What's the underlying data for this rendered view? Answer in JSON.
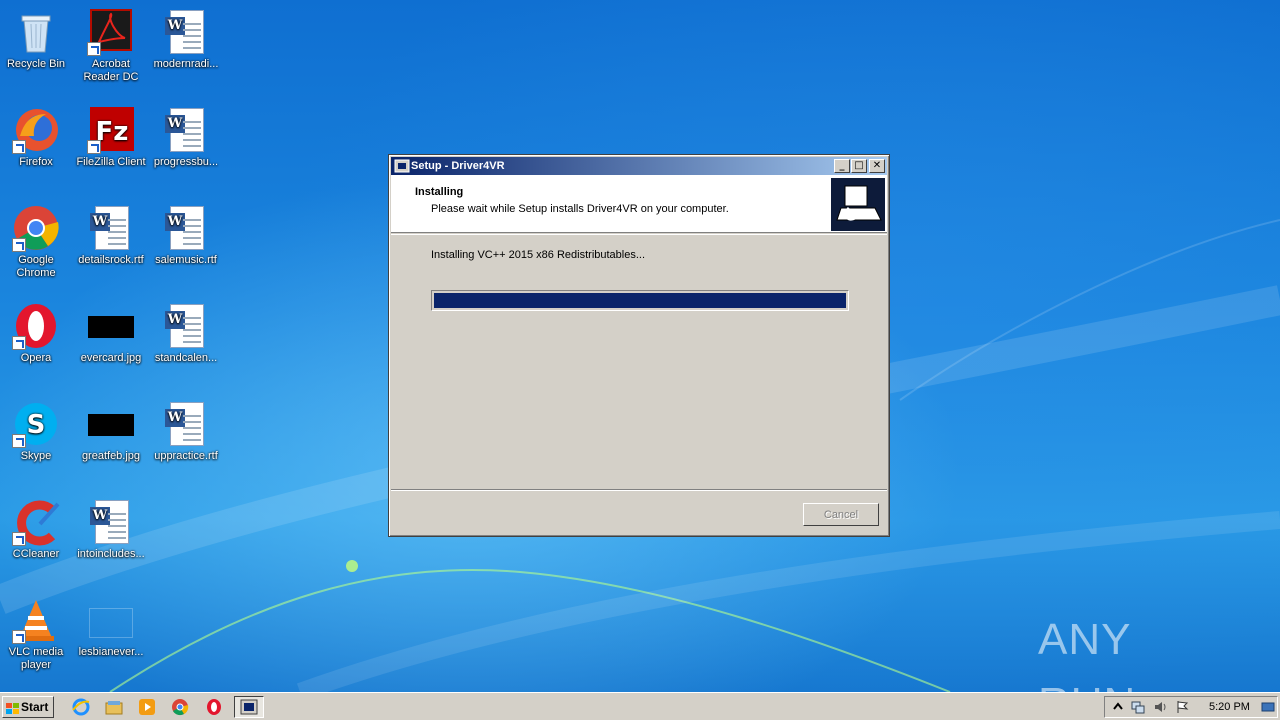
{
  "desktop": {
    "icons": [
      {
        "label": "Recycle Bin"
      },
      {
        "label": "Acrobat Reader DC"
      },
      {
        "label": "modernradi..."
      },
      {
        "label": "Firefox"
      },
      {
        "label": "FileZilla Client"
      },
      {
        "label": "progressbu..."
      },
      {
        "label": "Google Chrome"
      },
      {
        "label": "detailsrock.rtf"
      },
      {
        "label": "salemusic.rtf"
      },
      {
        "label": "Opera"
      },
      {
        "label": "evercard.jpg"
      },
      {
        "label": "standcalen..."
      },
      {
        "label": "Skype"
      },
      {
        "label": "greatfeb.jpg"
      },
      {
        "label": "uppractice.rtf"
      },
      {
        "label": "CCleaner"
      },
      {
        "label": "intoincludes..."
      },
      {
        "label": "VLC media player"
      },
      {
        "label": "lesbianever..."
      }
    ]
  },
  "dialog": {
    "title": "Setup - Driver4VR",
    "header_title": "Installing",
    "header_subtitle": "Please wait while Setup installs Driver4VR on your computer.",
    "status": "Installing VC++ 2015 x86 Redistributables...",
    "progress": 1.0,
    "cancel_label": "Cancel",
    "colors": {
      "title_start": "#0a246a",
      "title_end": "#a6caf0",
      "progress": "#0a246a"
    }
  },
  "watermark": {
    "text": "ANY RUN"
  },
  "taskbar": {
    "start_label": "Start",
    "clock": "5:20 PM",
    "quick_launch": [
      "ie-icon",
      "explorer-icon",
      "media-player-icon",
      "chrome-icon",
      "opera-icon"
    ]
  }
}
